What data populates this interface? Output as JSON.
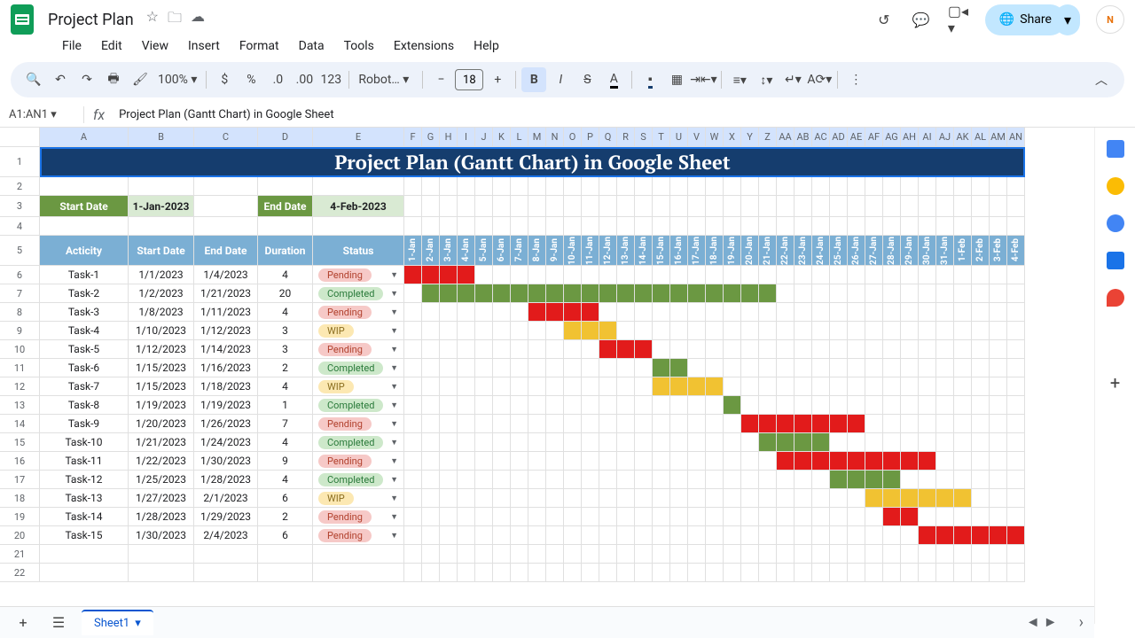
{
  "doc_title": "Project Plan",
  "menus": [
    "File",
    "Edit",
    "View",
    "Insert",
    "Format",
    "Data",
    "Tools",
    "Extensions",
    "Help"
  ],
  "share_label": "Share",
  "zoom": "100%",
  "font_name": "Robot…",
  "font_size": "18",
  "namebox": "A1:AN1",
  "formula_bar": "Project Plan (Gantt Chart) in Google Sheet",
  "sheet_tab": "Sheet1",
  "cols_main": [
    "A",
    "B",
    "C",
    "D",
    "E"
  ],
  "col_widths_main": [
    100,
    74,
    72,
    62,
    103
  ],
  "cols_day": [
    "F",
    "G",
    "H",
    "I",
    "J",
    "K",
    "L",
    "M",
    "N",
    "O",
    "P",
    "Q",
    "R",
    "S",
    "T",
    "U",
    "V",
    "W",
    "X",
    "Y",
    "Z",
    "AA",
    "AB",
    "AC",
    "AD",
    "AE",
    "AF",
    "AG",
    "AH",
    "AI",
    "AJ",
    "AK",
    "AL",
    "AM",
    "AN"
  ],
  "day_col_width": 20,
  "row1_title": "Project Plan (Gantt Chart) in Google Sheet",
  "row3": {
    "start_label": "Start Date",
    "start_val": "1-Jan-2023",
    "end_label": "End Date",
    "end_val": "4-Feb-2023"
  },
  "headers": [
    "Acticity",
    "Start Date",
    "End Date",
    "Duration",
    "Status"
  ],
  "day_headers": [
    "1-Jan",
    "2-Jan",
    "3-Jan",
    "4-Jan",
    "5-Jan",
    "6-Jan",
    "7-Jan",
    "8-Jan",
    "9-Jan",
    "10-Jan",
    "11-Jan",
    "12-Jan",
    "13-Jan",
    "14-Jan",
    "15-Jan",
    "16-Jan",
    "17-Jan",
    "18-Jan",
    "19-Jan",
    "20-Jan",
    "21-Jan",
    "22-Jan",
    "23-Jan",
    "24-Jan",
    "25-Jan",
    "26-Jan",
    "27-Jan",
    "28-Jan",
    "29-Jan",
    "30-Jan",
    "31-Jan",
    "1-Feb",
    "2-Feb",
    "3-Feb",
    "4-Feb"
  ],
  "tasks": [
    {
      "name": "Task-1",
      "start": "1/1/2023",
      "end": "1/4/2023",
      "dur": "4",
      "status": "Pending",
      "bar_start": 0,
      "bar_len": 4,
      "color": "red"
    },
    {
      "name": "Task-2",
      "start": "1/2/2023",
      "end": "1/21/2023",
      "dur": "20",
      "status": "Completed",
      "bar_start": 1,
      "bar_len": 20,
      "color": "green"
    },
    {
      "name": "Task-3",
      "start": "1/8/2023",
      "end": "1/11/2023",
      "dur": "4",
      "status": "Pending",
      "bar_start": 7,
      "bar_len": 4,
      "color": "red"
    },
    {
      "name": "Task-4",
      "start": "1/10/2023",
      "end": "1/12/2023",
      "dur": "3",
      "status": "WIP",
      "bar_start": 9,
      "bar_len": 3,
      "color": "yellow"
    },
    {
      "name": "Task-5",
      "start": "1/12/2023",
      "end": "1/14/2023",
      "dur": "3",
      "status": "Pending",
      "bar_start": 11,
      "bar_len": 3,
      "color": "red"
    },
    {
      "name": "Task-6",
      "start": "1/15/2023",
      "end": "1/16/2023",
      "dur": "2",
      "status": "Completed",
      "bar_start": 14,
      "bar_len": 2,
      "color": "green"
    },
    {
      "name": "Task-7",
      "start": "1/15/2023",
      "end": "1/18/2023",
      "dur": "4",
      "status": "WIP",
      "bar_start": 14,
      "bar_len": 4,
      "color": "yellow"
    },
    {
      "name": "Task-8",
      "start": "1/19/2023",
      "end": "1/19/2023",
      "dur": "1",
      "status": "Completed",
      "bar_start": 18,
      "bar_len": 1,
      "color": "green"
    },
    {
      "name": "Task-9",
      "start": "1/20/2023",
      "end": "1/26/2023",
      "dur": "7",
      "status": "Pending",
      "bar_start": 19,
      "bar_len": 7,
      "color": "red"
    },
    {
      "name": "Task-10",
      "start": "1/21/2023",
      "end": "1/24/2023",
      "dur": "4",
      "status": "Completed",
      "bar_start": 20,
      "bar_len": 4,
      "color": "green"
    },
    {
      "name": "Task-11",
      "start": "1/22/2023",
      "end": "1/30/2023",
      "dur": "9",
      "status": "Pending",
      "bar_start": 21,
      "bar_len": 9,
      "color": "red"
    },
    {
      "name": "Task-12",
      "start": "1/25/2023",
      "end": "1/28/2023",
      "dur": "4",
      "status": "Completed",
      "bar_start": 24,
      "bar_len": 4,
      "color": "green"
    },
    {
      "name": "Task-13",
      "start": "1/27/2023",
      "end": "2/1/2023",
      "dur": "6",
      "status": "WIP",
      "bar_start": 26,
      "bar_len": 6,
      "color": "yellow"
    },
    {
      "name": "Task-14",
      "start": "1/28/2023",
      "end": "1/29/2023",
      "dur": "2",
      "status": "Pending",
      "bar_start": 27,
      "bar_len": 2,
      "color": "red"
    },
    {
      "name": "Task-15",
      "start": "1/30/2023",
      "end": "2/4/2023",
      "dur": "6",
      "status": "Pending",
      "bar_start": 29,
      "bar_len": 6,
      "color": "red"
    }
  ],
  "blank_rows": [
    21,
    22
  ],
  "chart_data": {
    "type": "table",
    "title": "Project Plan (Gantt Chart) in Google Sheet",
    "note": "Gantt bars: bar_start is 0-index day offset from 1-Jan-2023; bar_len is bar span in days; color maps status (Pending=red, Completed=green, WIP=yellow).",
    "columns": [
      "Acticity",
      "Start Date",
      "End Date",
      "Duration",
      "Status"
    ],
    "rows": [
      [
        "Task-1",
        "1/1/2023",
        "1/4/2023",
        4,
        "Pending"
      ],
      [
        "Task-2",
        "1/2/2023",
        "1/21/2023",
        20,
        "Completed"
      ],
      [
        "Task-3",
        "1/8/2023",
        "1/11/2023",
        4,
        "Pending"
      ],
      [
        "Task-4",
        "1/10/2023",
        "1/12/2023",
        3,
        "WIP"
      ],
      [
        "Task-5",
        "1/12/2023",
        "1/14/2023",
        3,
        "Pending"
      ],
      [
        "Task-6",
        "1/15/2023",
        "1/16/2023",
        2,
        "Completed"
      ],
      [
        "Task-7",
        "1/15/2023",
        "1/18/2023",
        4,
        "WIP"
      ],
      [
        "Task-8",
        "1/19/2023",
        "1/19/2023",
        1,
        "Completed"
      ],
      [
        "Task-9",
        "1/20/2023",
        "1/26/2023",
        7,
        "Pending"
      ],
      [
        "Task-10",
        "1/21/2023",
        "1/24/2023",
        4,
        "Completed"
      ],
      [
        "Task-11",
        "1/22/2023",
        "1/30/2023",
        9,
        "Pending"
      ],
      [
        "Task-12",
        "1/25/2023",
        "1/28/2023",
        4,
        "Completed"
      ],
      [
        "Task-13",
        "1/27/2023",
        "2/1/2023",
        6,
        "WIP"
      ],
      [
        "Task-14",
        "1/28/2023",
        "1/29/2023",
        2,
        "Pending"
      ],
      [
        "Task-15",
        "1/30/2023",
        "2/4/2023",
        6,
        "Pending"
      ]
    ]
  }
}
